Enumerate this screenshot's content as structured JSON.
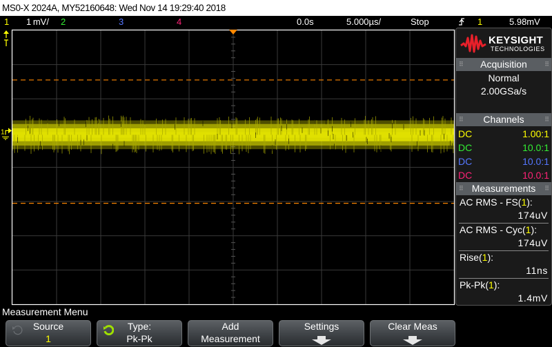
{
  "title_bar": {
    "text": "MS0-X 2024A, MY52160648: Wed Nov 14 19:29:40 2018"
  },
  "status_bar": {
    "ch1": {
      "label": "1",
      "color": "#ffff00"
    },
    "ch1_scale": "1 mV/",
    "ch2": {
      "label": "2",
      "color": "#33ee33"
    },
    "ch3": {
      "label": "3",
      "color": "#5577ff"
    },
    "ch4": {
      "label": "4",
      "color": "#ff2277"
    },
    "time_delay": "0.0s",
    "time_scale": "5.000µs/",
    "run_state": "Stop",
    "trigger_slope_icon": "rising-edge-icon",
    "trigger_source": "1",
    "trigger_level": "5.98mV"
  },
  "graticule": {
    "h_divisions": 10,
    "v_divisions": 8,
    "grid_color": "#3a3a3a",
    "border_color": "#ffffff",
    "trace_color": "#ffff00",
    "cursor_color": "#ff8800",
    "ch1_marker": "1",
    "trigger_marker": "T",
    "cursor_upper_div": 2.55,
    "cursor_lower_div": -1.05,
    "trace_center_div": 0.95,
    "trace_band_half_width_div": 0.42
  },
  "side_panel": {
    "logo": {
      "brand": "KEYSIGHT",
      "sub": "TECHNOLOGIES",
      "wave_color": "#e8202a"
    },
    "acquisition": {
      "header": "Acquisition",
      "mode": "Normal",
      "sample_rate": "2.00GSa/s"
    },
    "channels": {
      "header": "Channels",
      "rows": [
        {
          "coupling": "DC",
          "probe": "1.00:1",
          "color": "#ffff00"
        },
        {
          "coupling": "DC",
          "probe": "10.0:1",
          "color": "#33ee33"
        },
        {
          "coupling": "DC",
          "probe": "10.0:1",
          "color": "#5577ff"
        },
        {
          "coupling": "DC",
          "probe": "10.0:1",
          "color": "#ff2277"
        }
      ]
    },
    "measurements": {
      "header": "Measurements",
      "items": [
        {
          "name": "AC RMS - FS(",
          "source": "1",
          "suffix": "):",
          "value": "174uV"
        },
        {
          "name": "AC RMS - Cyc(",
          "source": "1",
          "suffix": "):",
          "value": "174uV"
        },
        {
          "name": "Rise(",
          "source": "1",
          "suffix": "):",
          "value": "11ns"
        },
        {
          "name": "Pk-Pk(",
          "source": "1",
          "suffix": "):",
          "value": "1.4mV"
        }
      ]
    }
  },
  "menu": {
    "title": "Measurement Menu",
    "softkeys": [
      {
        "line1": "Source",
        "line2": "1",
        "line2_color": "#ffff00",
        "icon": "knob-icon-dim"
      },
      {
        "line1": "Type:",
        "line2": "Pk-Pk",
        "line2_color": "#ffffff",
        "icon": "knob-icon-active"
      },
      {
        "line1": "Add",
        "line2": "Measurement",
        "line2_color": "#ffffff",
        "icon": ""
      },
      {
        "line1": "Settings",
        "line2": "",
        "icon": "submenu-arrow-icon"
      },
      {
        "line1": "Clear Meas",
        "line2": "",
        "icon": "submenu-arrow-icon"
      }
    ]
  }
}
